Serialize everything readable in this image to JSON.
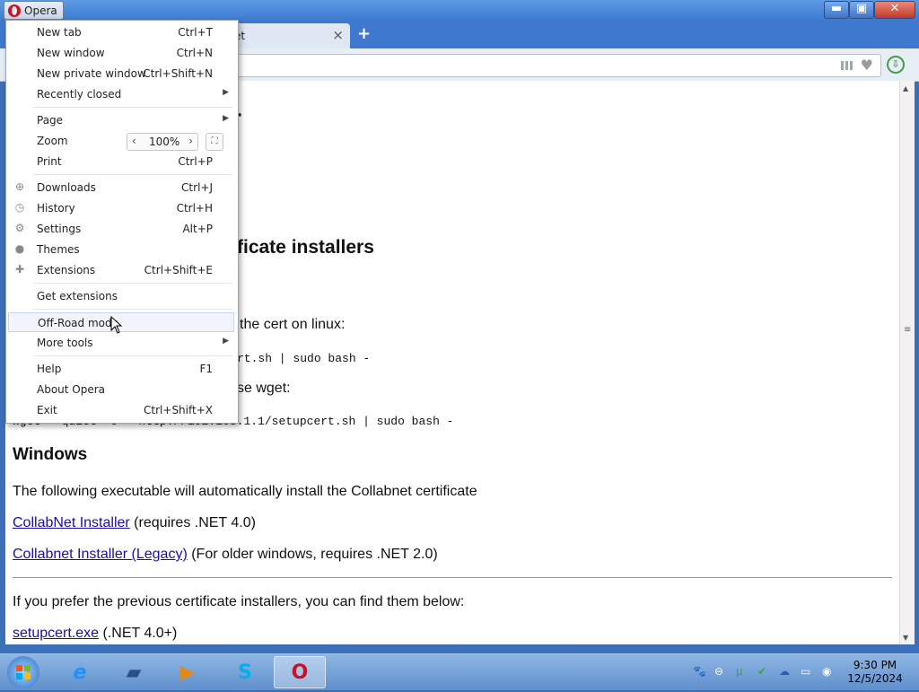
{
  "browser": {
    "menu_button_label": "Opera",
    "tab_title": "et",
    "tab_close": "×",
    "new_tab_symbol": "+",
    "window_controls": {
      "minimize": "▬",
      "maximize": "▣",
      "close": "✕"
    },
    "download_indicator": "⇩"
  },
  "menu": {
    "items": [
      {
        "label": "New tab",
        "shortcut": "Ctrl+T"
      },
      {
        "label": "New window",
        "shortcut": "Ctrl+N"
      },
      {
        "label": "New private window",
        "shortcut": "Ctrl+Shift+N"
      },
      {
        "label": "Recently closed",
        "shortcut": ""
      },
      {
        "label": "Page",
        "shortcut": ""
      },
      {
        "label": "Zoom",
        "shortcut": ""
      },
      {
        "label": "Print",
        "shortcut": "Ctrl+P"
      },
      {
        "label": "Downloads",
        "shortcut": "Ctrl+J"
      },
      {
        "label": "History",
        "shortcut": "Ctrl+H"
      },
      {
        "label": "Settings",
        "shortcut": "Alt+P"
      },
      {
        "label": "Themes",
        "shortcut": ""
      },
      {
        "label": "Extensions",
        "shortcut": "Ctrl+Shift+E"
      },
      {
        "label": "Get extensions",
        "shortcut": ""
      },
      {
        "label": "Off-Road mode",
        "shortcut": ""
      },
      {
        "label": "More tools",
        "shortcut": ""
      },
      {
        "label": "Help",
        "shortcut": "F1"
      },
      {
        "label": "About Opera",
        "shortcut": ""
      },
      {
        "label": "Exit",
        "shortcut": "Ctrl+Shift+X"
      }
    ],
    "zoom": {
      "decrease": "‹",
      "value": "100%",
      "increase": "›"
    }
  },
  "page": {
    "title_fragment": "r",
    "section_fragment": "ficate installers",
    "linux_text_fragment": "the cert on linux:",
    "curl_cmd_fragment": "rt.sh | sudo bash -",
    "wget_text_fragment": "se wget:",
    "wget_cmd_fragment": "wget --quiet -O - http://192.168.1.1/setupcert.sh | sudo bash -",
    "windows_heading": "Windows",
    "windows_text": "The following executable will automatically install the Collabnet certificate",
    "link1": "CollabNet Installer",
    "link1_note": " (requires .NET 4.0)",
    "link2": "Collabnet Installer (Legacy)",
    "link2_note": " (For older windows, requires .NET 2.0)",
    "prev_text": "If you prefer the previous certificate installers, you can find them below:",
    "link3": "setupcert.exe",
    "link3_note": " (.NET 4.0+)"
  },
  "taskbar": {
    "clock_time": "9:30 PM",
    "clock_date": "12/5/2024"
  }
}
